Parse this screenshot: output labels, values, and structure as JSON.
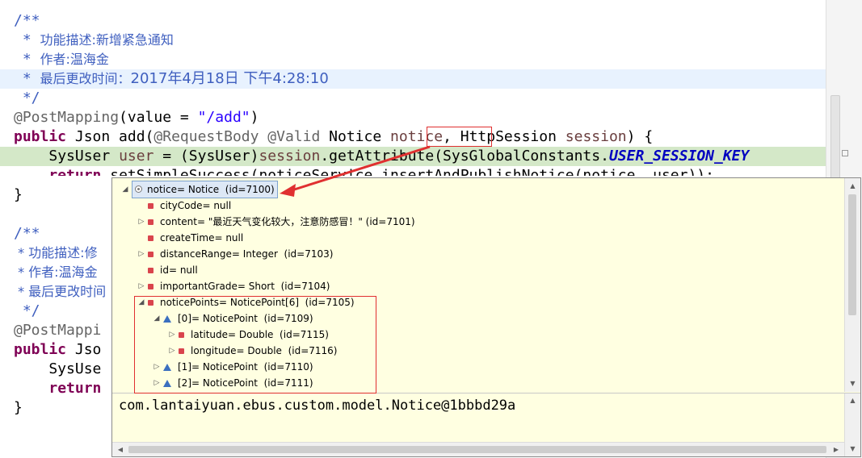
{
  "editor": {
    "doc1": {
      "open": "/**",
      "star": " * ",
      "desc_label": "功能描述:",
      "desc_value": "新增紧急通知",
      "author_label": "作者:",
      "author_value": "温海金",
      "modified_label": "最后更改时间：",
      "modified_value": "2017年4月18日 下午4:28:10",
      "close": " */"
    },
    "mapping1": {
      "annotation": "@PostMapping",
      "open": "(value = ",
      "path": "\"/add\"",
      "close": ")"
    },
    "method1": {
      "kw_public": "public",
      "sig_a": " Json add(",
      "ann1": "@RequestBody",
      "sp1": " ",
      "ann2": "@Valid",
      "sig_b": " Notice ",
      "param1": "notice",
      "sig_c": ", HttpSession ",
      "param2": "session",
      "sig_d": ") {"
    },
    "line_user": {
      "indent": "    ",
      "type": "SysUser ",
      "var": "user",
      "mid": " = (SysUser)",
      "session": "session",
      "call": ".getAttribute(SysGlobalConstants.",
      "constant": "USER_SESSION_KEY"
    },
    "line_return": {
      "indent": "    ",
      "kw": "return",
      "rest": " setSimpleSuccess(noticeService.insertAndPublishNotice(notice, user));"
    },
    "brace_close": "}",
    "doc2": {
      "open": "/**",
      "desc": " * 功能描述:修",
      "author": " * 作者:温海金",
      "modified": " * 最后更改时间",
      "close": " */"
    },
    "mapping2": "@PostMappi",
    "method2": {
      "kw": "public",
      "rest": " Jso"
    },
    "line_user2": "    SysUse",
    "line_return2": {
      "indent": "    ",
      "kw": "return"
    },
    "brace_close2": "}"
  },
  "debug_popup": {
    "root": "notice= Notice  (id=7100)",
    "fields": [
      {
        "label": "cityCode= null"
      },
      {
        "label": "content= \"最近天气变化较大，注意防感冒！\" (id=7101)"
      },
      {
        "label": "createTime= null"
      },
      {
        "label": "distanceRange= Integer  (id=7103)"
      },
      {
        "label": "id= null"
      },
      {
        "label": "importantGrade= Short  (id=7104)"
      },
      {
        "label": "noticePoints= NoticePoint[6]  (id=7105)"
      },
      {
        "label": "[0]= NoticePoint  (id=7109)"
      },
      {
        "label": "latitude= Double  (id=7115)"
      },
      {
        "label": "longitude= Double  (id=7116)"
      },
      {
        "label": "[1]= NoticePoint  (id=7110)"
      },
      {
        "label": "[2]= NoticePoint  (id=7111)"
      }
    ],
    "detail_value": "com.lantaiyuan.ebus.custom.model.Notice@1bbbd29a"
  },
  "colors": {
    "popup_bg": "#ffffe1",
    "annotation_box": "#e03030",
    "doc_comment": "#3f5fbf",
    "keyword": "#7f0055",
    "string": "#2a00ff"
  }
}
